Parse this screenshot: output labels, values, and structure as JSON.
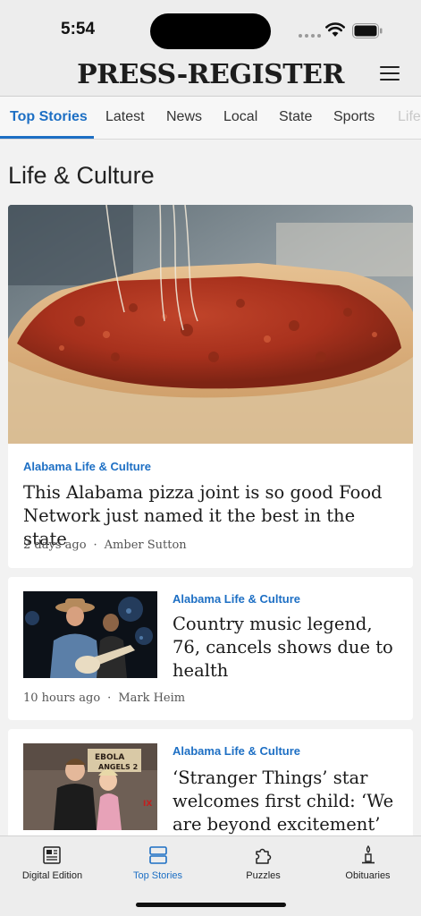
{
  "status": {
    "time": "5:54"
  },
  "masthead": {
    "brand": "PRESS-REGISTER"
  },
  "tabs": [
    {
      "label": "Top Stories"
    },
    {
      "label": "Latest"
    },
    {
      "label": "News"
    },
    {
      "label": "Local"
    },
    {
      "label": "State"
    },
    {
      "label": "Sports"
    },
    {
      "label": "Life"
    }
  ],
  "section": {
    "title": "Life & Culture"
  },
  "articles": [
    {
      "kicker": "Alabama Life & Culture",
      "headline": "This Alabama pizza joint is so good Food Network just named it the best in the state",
      "age": "2 days ago",
      "author": "Amber Sutton"
    },
    {
      "kicker": "Alabama Life & Culture",
      "headline": "Country music legend, 76, cancels shows due to health",
      "age": "10 hours ago",
      "author": "Mark Heim"
    },
    {
      "kicker": "Alabama Life & Culture",
      "headline": "‘Stranger Things’ star welcomes first child: ‘We are beyond excitement’"
    }
  ],
  "photo_text": {
    "sign_line1": "EBOLA",
    "sign_line2": "ANGELS 2",
    "sign_side": "IX"
  },
  "bottom_nav": [
    {
      "label": "Digital Edition",
      "icon": "newspaper-icon"
    },
    {
      "label": "Top Stories",
      "icon": "stack-icon"
    },
    {
      "label": "Puzzles",
      "icon": "puzzle-icon"
    },
    {
      "label": "Obituaries",
      "icon": "candle-icon"
    }
  ],
  "colors": {
    "accent": "#1d6fc4",
    "background": "#f2f2f2",
    "card": "#ffffff"
  }
}
